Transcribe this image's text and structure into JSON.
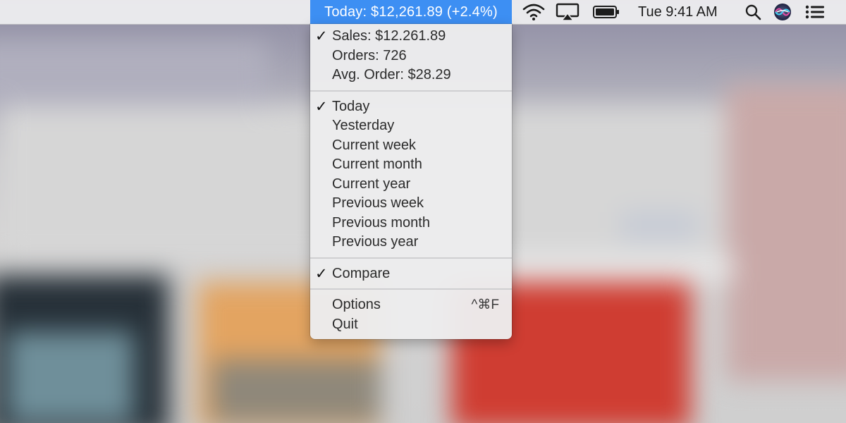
{
  "menubar": {
    "status_title": "Today: $12,261.89 (+2.4%)",
    "clock": "Tue 9:41 AM",
    "icons": [
      "wifi-icon",
      "airplay-icon",
      "battery-icon",
      "spotlight-search-icon",
      "siri-icon",
      "notification-center-icon"
    ]
  },
  "menu": {
    "stats": [
      {
        "label": "Sales: $12.261.89",
        "checked": true
      },
      {
        "label": "Orders: 726",
        "checked": false
      },
      {
        "label": "Avg. Order: $28.29",
        "checked": false
      }
    ],
    "periods": [
      {
        "label": "Today",
        "checked": true
      },
      {
        "label": "Yesterday",
        "checked": false
      },
      {
        "label": "Current week",
        "checked": false
      },
      {
        "label": "Current month",
        "checked": false
      },
      {
        "label": "Current year",
        "checked": false
      },
      {
        "label": "Previous week",
        "checked": false
      },
      {
        "label": "Previous month",
        "checked": false
      },
      {
        "label": "Previous year",
        "checked": false
      }
    ],
    "compare": {
      "label": "Compare",
      "checked": true
    },
    "options": {
      "label": "Options",
      "shortcut": "^⌘F"
    },
    "quit": {
      "label": "Quit"
    },
    "check_glyph": "✓"
  },
  "colors": {
    "highlight": "#3d8ff3",
    "menubar": "#ececee"
  }
}
